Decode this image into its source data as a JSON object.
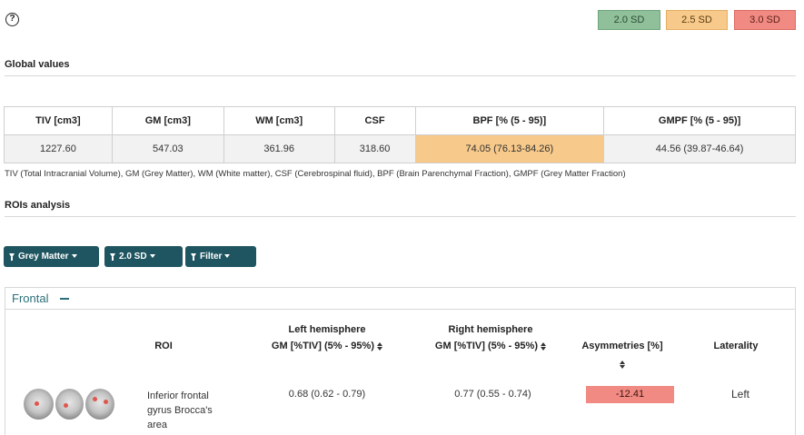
{
  "legend": {
    "sd2": "2.0 SD",
    "sd25": "2.5 SD",
    "sd3": "3.0 SD",
    "colors": {
      "sd2": "#8fc09a",
      "sd25": "#f7c98a",
      "sd3": "#f08a82"
    }
  },
  "global": {
    "title": "Global values",
    "headers": [
      "TIV [cm3]",
      "GM [cm3]",
      "WM [cm3]",
      "CSF",
      "BPF [% (5 - 95)]",
      "GMPF [% (5 - 95)]"
    ],
    "values": [
      "1227.60",
      "547.03",
      "361.96",
      "318.60",
      "74.05 (76.13-84.26)",
      "44.56 (39.87-46.64)"
    ],
    "footnote": "TIV (Total Intracranial Volume), GM (Grey Matter), WM (White matter), CSF (Cerebrospinal fluid), BPF (Brain Parenchymal Fraction), GMPF (Grey Matter Fraction)"
  },
  "rois": {
    "title": "ROIs analysis",
    "buttons": {
      "tissue": "Grey Matter",
      "sd": "2.0 SD",
      "filter": "Filter"
    },
    "panel_title": "Frontal",
    "columns": {
      "roi": "ROI",
      "left_title": "Left hemisphere",
      "left_sub": "GM [%TIV] (5% - 95%)",
      "right_title": "Right hemisphere",
      "right_sub": "GM [%TIV] (5% - 95%)",
      "asym": "Asymmetries [%]",
      "laterality": "Laterality"
    },
    "row": {
      "roi_line1": "Inferior frontal",
      "roi_line2": "gyrus Brocca's",
      "roi_line3": "area",
      "left": "0.68 (0.62 - 0.79)",
      "right": "0.77 (0.55 - 0.74)",
      "asym": "-12.41",
      "laterality": "Left"
    }
  }
}
